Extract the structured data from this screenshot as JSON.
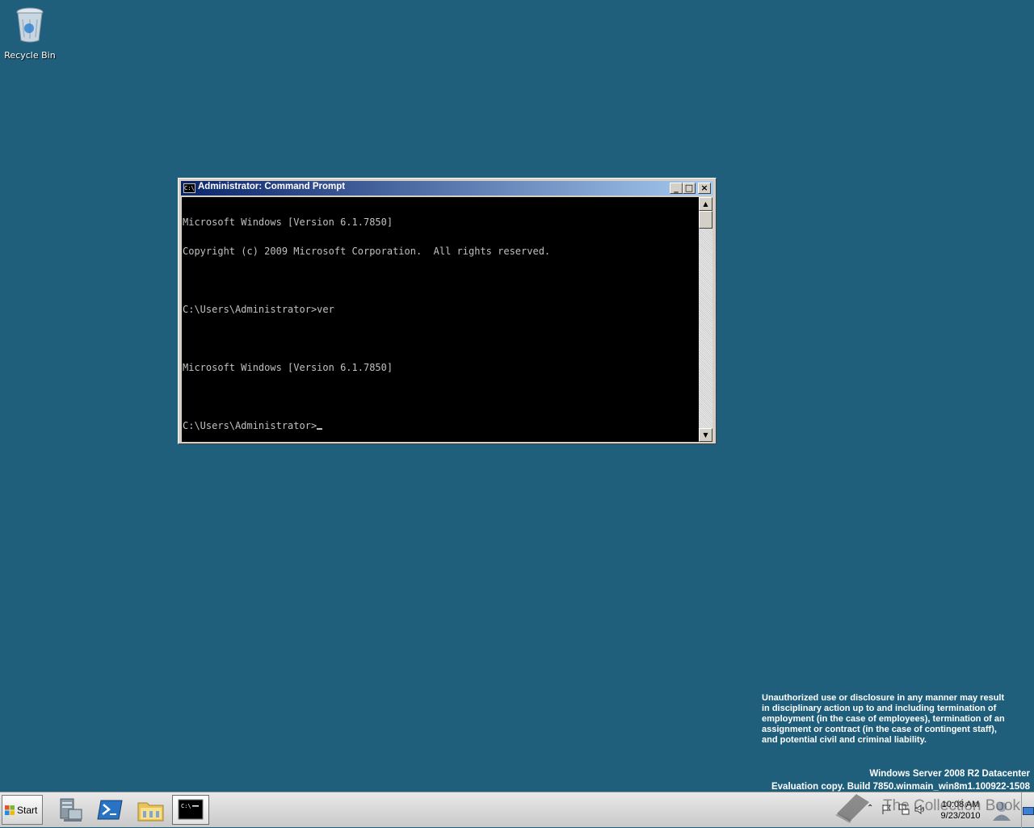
{
  "desktop": {
    "icons": [
      {
        "label": "Recycle Bin",
        "icon": "recycle-bin-icon"
      }
    ],
    "legal_notice": [
      "Unauthorized use or disclosure in any manner may result",
      "in disciplinary action up to and including termination of",
      "employment (in the case of employees), termination of an",
      "assignment or contract (in the case of contingent staff),",
      "and potential civil and criminal liability."
    ],
    "edition": "Windows Server 2008 R2 Datacenter",
    "build": "Evaluation copy. Build 7850.winmain_win8m1.100922-1508",
    "background_color": "#1f5f7c"
  },
  "window": {
    "title": "Administrator: Command Prompt",
    "icon": "cmd-icon",
    "console_lines": [
      "Microsoft Windows [Version 6.1.7850]",
      "Copyright (c) 2009 Microsoft Corporation.  All rights reserved.",
      "",
      "C:\\Users\\Administrator>ver",
      "",
      "Microsoft Windows [Version 6.1.7850]",
      "",
      "C:\\Users\\Administrator>"
    ]
  },
  "taskbar": {
    "start_label": "Start",
    "pinned": [
      {
        "name": "server-manager-icon"
      },
      {
        "name": "powershell-icon"
      },
      {
        "name": "explorer-icon"
      },
      {
        "name": "cmd-icon",
        "active": true
      }
    ],
    "clock": {
      "time": "10:08 AM",
      "date": "9/23/2010"
    }
  },
  "watermark": "The Collection Book"
}
